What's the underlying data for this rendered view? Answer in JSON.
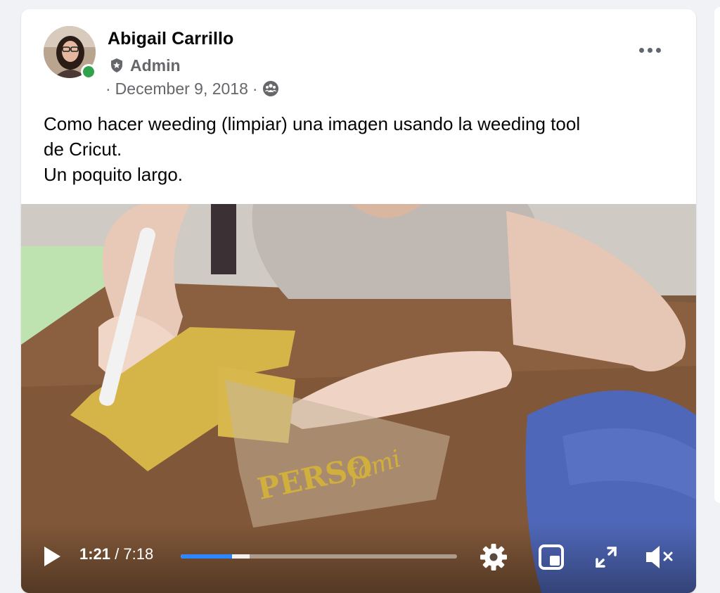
{
  "post": {
    "author": "Abigail Carrillo",
    "role": "Admin",
    "date": "December 9, 2018",
    "date_prefix": "·",
    "date_suffix": "·",
    "audience_icon": "group-icon",
    "text_lines": [
      "Como hacer weeding (limpiar) una imagen usando la weeding tool",
      "de Cricut.",
      "Un poquito largo."
    ],
    "online": true
  },
  "video": {
    "current_time": "1:21",
    "time_separator": "/",
    "duration": "7:18",
    "played_fraction": 0.185,
    "buffered_fraction": 0.25,
    "icons": {
      "play": "play-icon",
      "settings": "gear-icon",
      "pip": "picture-in-picture-icon",
      "fullscreen": "fullscreen-icon",
      "mute": "muted-speaker-icon"
    }
  },
  "colors": {
    "accent": "#2d88ff",
    "online": "#31a24c",
    "secondary_text": "#65676b"
  }
}
